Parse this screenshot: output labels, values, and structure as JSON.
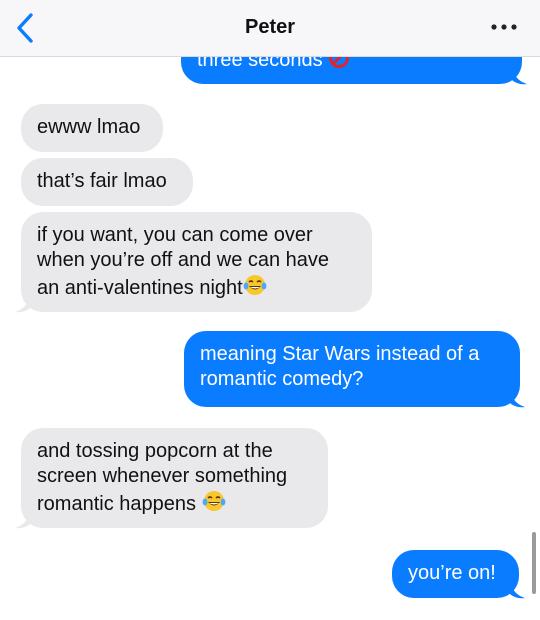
{
  "header": {
    "contact_name": "Peter",
    "back_icon": "chevron-left-icon",
    "more_icon": "ellipsis-icon"
  },
  "messages": [
    {
      "direction": "outgoing",
      "text": "three seconds",
      "emoji": "prohibited-icon"
    },
    {
      "direction": "incoming",
      "text": "ewww lmao"
    },
    {
      "direction": "incoming",
      "text": "that’s fair lmao"
    },
    {
      "direction": "incoming",
      "lines": [
        "if you want, you can come over",
        "when you’re off and we can have",
        "an anti-valentines night"
      ],
      "emoji": "laughing-tears-emoji"
    },
    {
      "direction": "outgoing",
      "lines": [
        "meaning Star Wars instead of a",
        "romantic comedy?"
      ]
    },
    {
      "direction": "incoming",
      "lines": [
        "and tossing popcorn at the",
        "screen whenever something",
        "romantic happens "
      ],
      "emoji": "laughing-tears-emoji"
    },
    {
      "direction": "outgoing",
      "text": "you’re on!"
    }
  ],
  "colors": {
    "incoming_bubble": "#e9e9eb",
    "outgoing_bubble": "#0a7cff",
    "accent": "#0a7cff"
  }
}
